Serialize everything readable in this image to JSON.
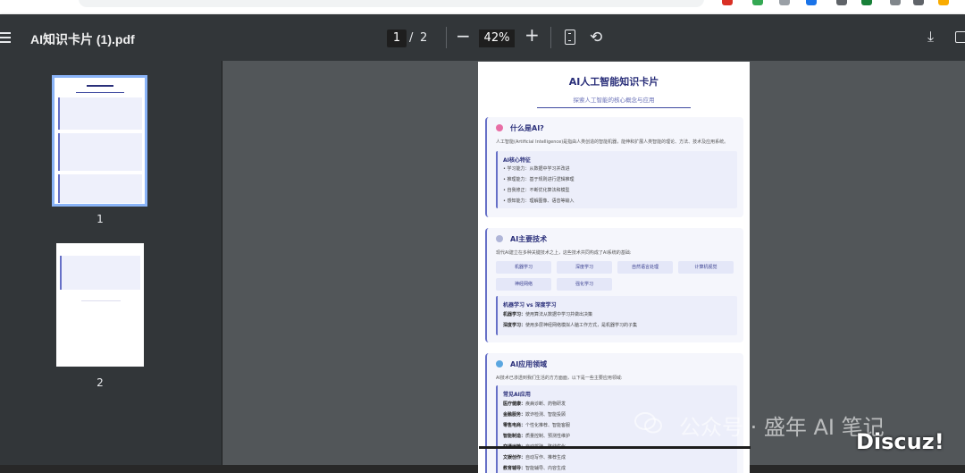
{
  "toolbar": {
    "title": "AI知识卡片 (1).pdf",
    "current_page": "1",
    "page_separator": "/",
    "total_pages": "2",
    "zoom_out": "−",
    "zoom_level": "42%",
    "zoom_in": "+",
    "rotate": "⟲",
    "download": "⤓"
  },
  "sidebar": {
    "thumbnails": [
      {
        "label": "1"
      },
      {
        "label": "2"
      }
    ]
  },
  "document": {
    "title": "AI人工智能知识卡片",
    "subtitle": "探索人工智能的核心概念与应用",
    "sections": [
      {
        "heading": "什么是AI?",
        "desc": "人工智能(Artificial Intelligence)是指由人类创造的智能机器，能伸和扩展人类智能的理论、方法、技术及应用系统。",
        "box_title": "AI核心特征",
        "items": [
          "• 学习能力：从数据中学习并改进",
          "• 推理能力：基于规则进行逻辑推理",
          "• 自我修正：不断优化算法和模型",
          "• 感知能力：理解图像、语音等输入"
        ]
      },
      {
        "heading": "AI主要技术",
        "desc": "现代AI建立在多种关键技术之上，这些技术共同构成了AI系统的基础:",
        "techs": [
          "机器学习",
          "深度学习",
          "自然语言处理",
          "计算机视觉",
          "神经网络",
          "强化学习"
        ],
        "box_title": "机器学习 vs 深度学习",
        "items": [
          {
            "k": "机器学习：",
            "v": "使用算法从数据中学习并做出决策"
          },
          {
            "k": "深度学习：",
            "v": "使用多层神经网络模拟人脑工作方式，是机器学习的子集"
          }
        ]
      },
      {
        "heading": "AI应用领域",
        "desc": "AI技术已渗透到我们生活的方方面面，以下是一些主要应用领域:",
        "box_title": "常见AI应用",
        "items": [
          {
            "k": "医疗健康：",
            "v": "疾病诊断、药物研发"
          },
          {
            "k": "金融服务：",
            "v": "欺诈检测、智能投顾"
          },
          {
            "k": "零售电商：",
            "v": "个性化推荐、智能客服"
          },
          {
            "k": "智能制造：",
            "v": "质量控制、预测性维护"
          },
          {
            "k": "交通运输：",
            "v": "自动驾驶、路线优化"
          },
          {
            "k": "文娱创作：",
            "v": "自动写作、推荐生成"
          },
          {
            "k": "教育辅导：",
            "v": "智能辅导、内容生成"
          }
        ]
      }
    ]
  },
  "watermark": {
    "text": "公众号 · 盛年 AI 笔记",
    "brand": "Discuz!"
  }
}
